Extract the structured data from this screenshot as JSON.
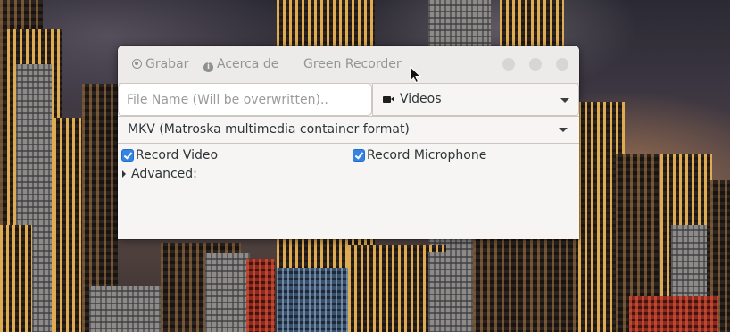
{
  "app": {
    "title": "Green Recorder"
  },
  "header": {
    "record_label": "Grabar",
    "about_label": "Acerca de"
  },
  "form": {
    "file_name": {
      "value": "",
      "placeholder": "File Name (Will be overwritten).."
    },
    "folder": {
      "selected": "Videos",
      "icon": "video-camera-icon"
    },
    "format": {
      "selected": "MKV (Matroska multimedia container format)"
    },
    "options": {
      "record_video": {
        "label": "Record Video",
        "checked": true
      },
      "record_microphone": {
        "label": "Record Microphone",
        "checked": true
      }
    },
    "advanced_label": "Advanced:"
  },
  "colors": {
    "accent": "#3584e4",
    "window_bg": "#f6f5f4",
    "header_text": "#929595"
  }
}
